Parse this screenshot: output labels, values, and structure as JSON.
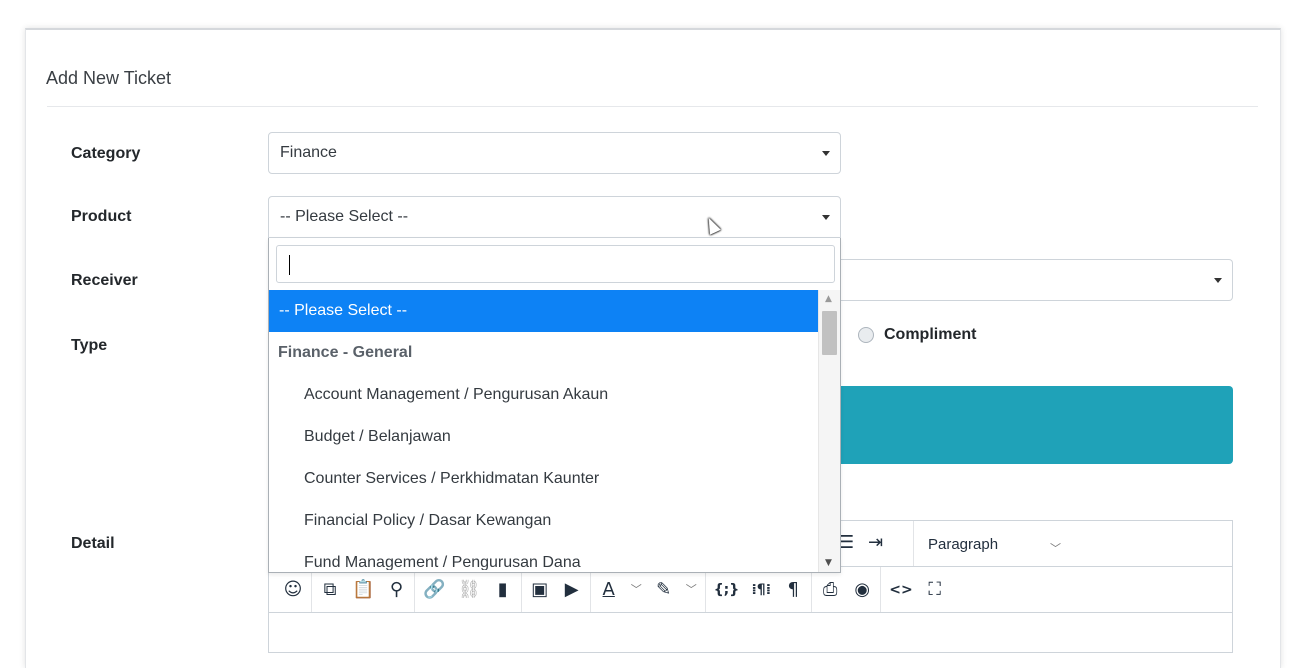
{
  "form": {
    "title": "Add New Ticket",
    "category": {
      "label": "Category",
      "value": "Finance"
    },
    "product": {
      "label": "Product",
      "value": "-- Please Select --"
    },
    "receiver": {
      "label": "Receiver"
    },
    "type": {
      "label": "Type",
      "visible_option": "Compliment"
    },
    "detail": {
      "label": "Detail"
    }
  },
  "dropdown": {
    "search_value": "",
    "items": [
      {
        "label": "-- Please Select --",
        "kind": "selected"
      },
      {
        "label": "Finance - General",
        "kind": "group"
      },
      {
        "label": "Account Management / Pengurusan Akaun",
        "kind": "option"
      },
      {
        "label": "Budget / Belanjawan",
        "kind": "option"
      },
      {
        "label": "Counter Services / Perkhidmatan Kaunter",
        "kind": "option"
      },
      {
        "label": "Financial Policy / Dasar Kewangan",
        "kind": "option"
      },
      {
        "label": "Fund Management / Pengurusan Dana",
        "kind": "option"
      }
    ]
  },
  "editor": {
    "block_format": "Paragraph",
    "toolbar_icons": [
      "emoji-icon",
      "copy-icon",
      "paste-icon",
      "search-icon",
      "link-icon",
      "unlink-icon",
      "bookmark-icon",
      "image-icon",
      "media-icon",
      "text-color-icon",
      "highlight-icon",
      "code-sample-icon",
      "nonbreaking-icon",
      "pilcrow-icon",
      "print-icon",
      "preview-icon",
      "source-code-icon",
      "fullscreen-icon"
    ]
  },
  "colors": {
    "selected_option": "#0d82f5",
    "info_alert": "#1fa2b8"
  }
}
